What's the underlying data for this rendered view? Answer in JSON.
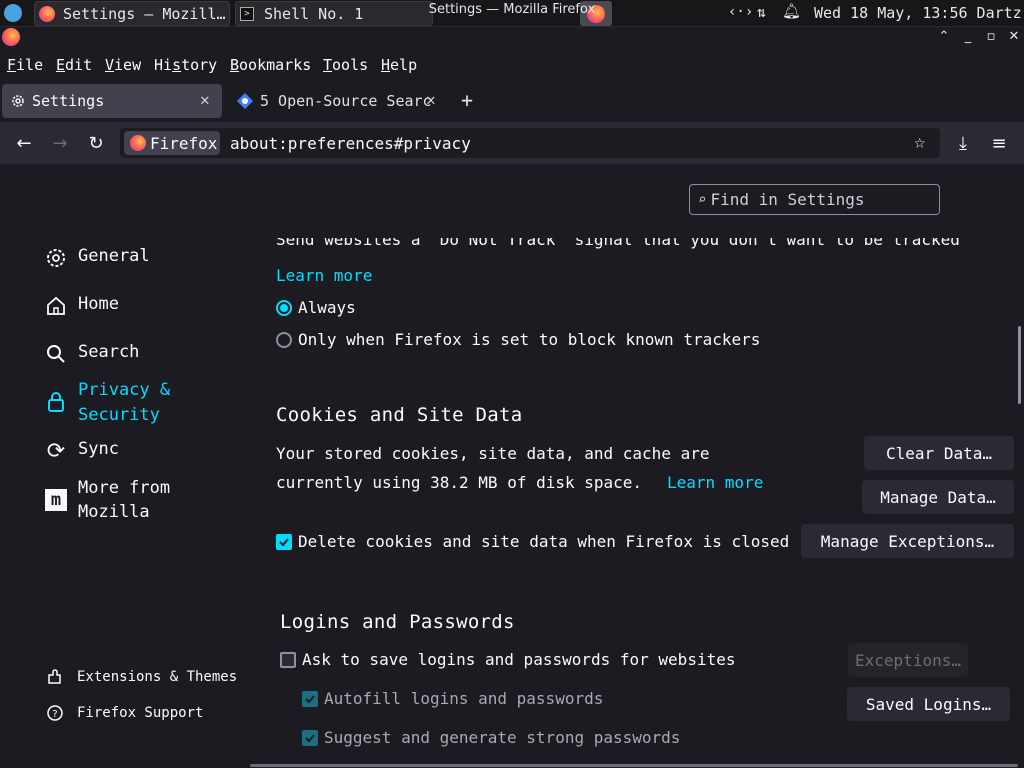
{
  "system_bar": {
    "task_settings": "Settings — Mozill…",
    "task_shell": "Shell No. 1",
    "clock": "Wed 18 May, 13:56  Dartz"
  },
  "window": {
    "title": "Settings — Mozilla Firefox"
  },
  "menubar": {
    "file": {
      "key": "F",
      "rest": "ile"
    },
    "edit": {
      "key": "E",
      "rest": "dit"
    },
    "view": {
      "key": "V",
      "rest": "iew"
    },
    "history": {
      "pre": "Hi",
      "key": "s",
      "rest": "tory"
    },
    "bookmarks": {
      "key": "B",
      "rest": "ookmarks"
    },
    "tools": {
      "key": "T",
      "rest": "ools"
    },
    "help": {
      "key": "H",
      "rest": "elp"
    }
  },
  "tabs": {
    "settings": "Settings",
    "other": "5 Open-Source Searc"
  },
  "navbar": {
    "identity": "Firefox",
    "url": "about:preferences#privacy"
  },
  "search": {
    "placeholder": "Find in Settings"
  },
  "sidebar": {
    "general": "General",
    "home": "Home",
    "search": "Search",
    "privacy_line1": "Privacy &",
    "privacy_line2": "Security",
    "sync": "Sync",
    "more_line1": "More from",
    "more_line2": "Mozilla",
    "extensions": "Extensions & Themes",
    "support": "Firefox Support"
  },
  "dnt": {
    "cut_text": "Send websites a “Do Not Track” signal that you don’t want to be tracked",
    "learn_more": "Learn more",
    "always": "Always",
    "only_when": "Only when Firefox is set to block known trackers",
    "selected": "always"
  },
  "cookies": {
    "heading": "Cookies and Site Data",
    "desc_line1": "Your stored cookies, site data, and cache are",
    "desc_line2": "currently using 38.2 MB of disk space.",
    "learn_more": "Learn more",
    "clear_btn": "Clear Data…",
    "manage_btn": "Manage Data…",
    "delete_label": "Delete cookies and site data when Firefox is closed",
    "delete_checked": true,
    "exceptions_btn": "Manage Exceptions…"
  },
  "logins": {
    "heading": "Logins and Passwords",
    "ask_label": "Ask to save logins and passwords for websites",
    "ask_checked": false,
    "autofill_label": "Autofill logins and passwords",
    "suggest_label": "Suggest and generate strong passwords",
    "exceptions_btn": "Exceptions…",
    "saved_btn": "Saved Logins…"
  },
  "colors": {
    "accent": "#00ddff",
    "bg": "#1c1b22",
    "toolbar": "#2b2a33"
  }
}
